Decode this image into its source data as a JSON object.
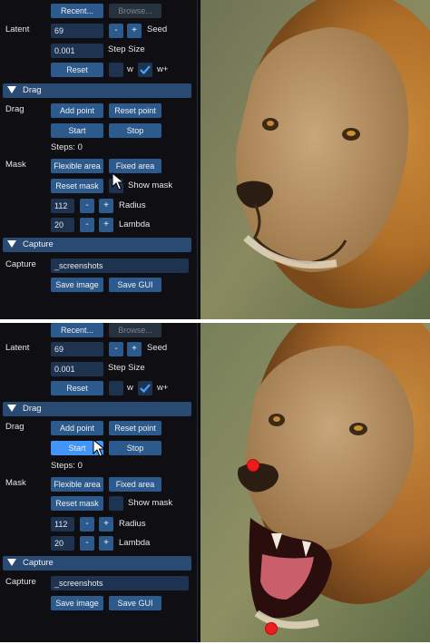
{
  "frames": [
    {
      "recent_label": "Recent...",
      "browse_label": "Browse...",
      "latent_label": "Latent",
      "seed_value": "69",
      "minus": "-",
      "plus": "+",
      "seed_label": "Seed",
      "step_value": "0.001",
      "step_label": "Step Size",
      "reset_label": "Reset",
      "w_label": "w",
      "wplus_label": "w+",
      "drag_header": "Drag",
      "drag_label": "Drag",
      "add_point_label": "Add point",
      "reset_point_label": "Reset point",
      "start_label": "Start",
      "stop_label": "Stop",
      "steps_text": "Steps: 0",
      "mask_label": "Mask",
      "flexible_area_label": "Flexible area",
      "fixed_area_label": "Fixed area",
      "reset_mask_label": "Reset mask",
      "show_mask_label": "Show mask",
      "radius_value": "112",
      "radius_label": "Radius",
      "lambda_value": "20",
      "lambda_label": "Lambda",
      "capture_header": "Capture",
      "capture_label": "Capture",
      "capture_value": "_screenshots",
      "save_image_label": "Save image",
      "save_gui_label": "Save GUI"
    },
    {
      "recent_label": "Recent...",
      "browse_label": "Browse...",
      "latent_label": "Latent",
      "seed_value": "69",
      "minus": "-",
      "plus": "+",
      "seed_label": "Seed",
      "step_value": "0.001",
      "step_label": "Step Size",
      "reset_label": "Reset",
      "w_label": "w",
      "wplus_label": "w+",
      "drag_header": "Drag",
      "drag_label": "Drag",
      "add_point_label": "Add point",
      "reset_point_label": "Reset point",
      "start_label": "Start",
      "stop_label": "Stop",
      "steps_text": "Steps: 0",
      "mask_label": "Mask",
      "flexible_area_label": "Flexible area",
      "fixed_area_label": "Fixed area",
      "reset_mask_label": "Reset mask",
      "show_mask_label": "Show mask",
      "radius_value": "112",
      "radius_label": "Radius",
      "lambda_value": "20",
      "lambda_label": "Lambda",
      "capture_header": "Capture",
      "capture_label": "Capture",
      "capture_value": "_screenshots",
      "save_image_label": "Save image",
      "save_gui_label": "Save GUI"
    }
  ],
  "colors": {
    "button": "#2d5a8c",
    "button_active": "#4296fa",
    "input": "#1e3350",
    "header": "#294a72",
    "panel_bg": "#0f0f13",
    "handle_point": "#ee1c1c"
  }
}
